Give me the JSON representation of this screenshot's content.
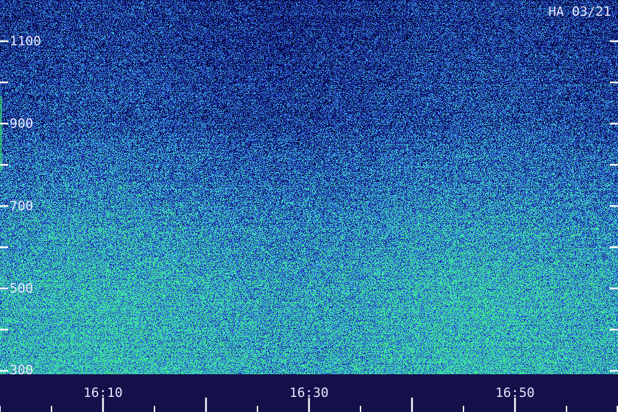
{
  "chart_data": {
    "type": "heatmap",
    "title": "HA 03/21",
    "xlabel": "",
    "ylabel": "",
    "x_tick_labels": [
      "16:10",
      "16:30",
      "16:50"
    ],
    "y_tick_labels": [
      "1100",
      "900",
      "700",
      "500",
      "300"
    ],
    "ylim": [
      300,
      1100
    ],
    "colormap": [
      "#000028",
      "#1a1aa0",
      "#2f67d6",
      "#3fd0dc",
      "#3ef07a"
    ],
    "intensity_by_y": [
      {
        "y": 1100,
        "level": 0.25
      },
      {
        "y": 900,
        "level": 0.35
      },
      {
        "y": 800,
        "level": 0.45
      },
      {
        "y": 700,
        "level": 0.55
      },
      {
        "y": 500,
        "level": 0.7
      },
      {
        "y": 300,
        "level": 0.72
      }
    ]
  }
}
